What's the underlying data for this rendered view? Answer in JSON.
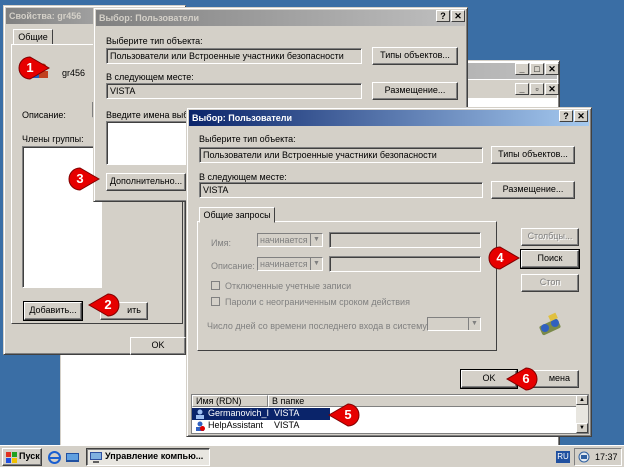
{
  "desktop": {
    "bg": "#3a6ea5"
  },
  "props_window": {
    "title": "Свойства: gr456",
    "tab_general": "Общие",
    "group_name": "gr456",
    "description_label": "Описание:",
    "members_label": "Члены группы:",
    "add_button": "Добавить...",
    "remove_button_partial": "ить",
    "ok_button": "OK"
  },
  "select_users_1": {
    "title": "Выбор: Пользователи",
    "object_type_label": "Выберите тип объекта:",
    "object_type_value": "Пользователи или Встроенные участники безопасности",
    "object_types_button": "Типы объектов...",
    "location_label": "В следующем месте:",
    "location_value": "VISTA",
    "locations_button": "Размещение...",
    "enter_names_label": "Введите имена выбр",
    "advanced_button": "Дополнительно..."
  },
  "select_users_2": {
    "title": "Выбор: Пользователи",
    "object_type_label": "Выберите тип объекта:",
    "object_type_value": "Пользователи или Встроенные участники безопасности",
    "object_types_button": "Типы объектов...",
    "location_label": "В следующем месте:",
    "location_value": "VISTA",
    "locations_button": "Размещение...",
    "tab_common_queries": "Общие запросы",
    "name_label": "Имя:",
    "name_combo": "начинается",
    "desc_label": "Описание:",
    "desc_combo": "начинается",
    "disabled_accounts": "Отключенные учетные записи",
    "no_expire_pwd": "Пароли с неограниченным сроком действия",
    "days_since_logon": "Число дней со времени последнего входа в систему:",
    "columns_button": "Столбцы...",
    "search_button": "Поиск",
    "stop_button": "Стоп",
    "ok_button": "OK",
    "cancel_partial": "мена",
    "results_columns": [
      "Имя (RDN)",
      "В папке"
    ],
    "results": [
      {
        "name": "Germanovich_I",
        "folder": "VISTA"
      },
      {
        "name": "HelpAssistant",
        "folder": "VISTA"
      }
    ]
  },
  "badges": [
    "1",
    "2",
    "3",
    "4",
    "5",
    "6"
  ],
  "taskbar": {
    "start": "Пуск",
    "task": "Управление компью...",
    "lang": "RU",
    "clock": "17:37"
  },
  "colors": {
    "accent_badge": "#e60000",
    "title_active": "#0a246a",
    "selection": "#0a246a"
  }
}
